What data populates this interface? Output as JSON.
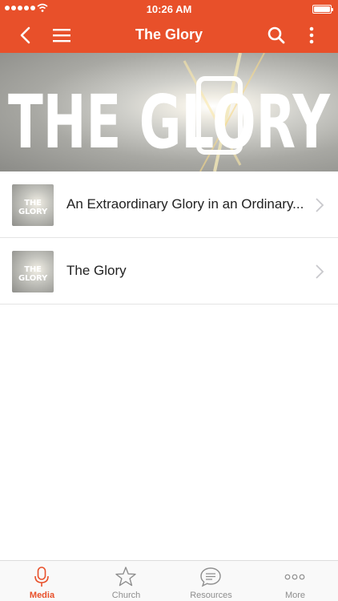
{
  "status_bar": {
    "time": "10:26 AM"
  },
  "nav": {
    "title": "The Glory"
  },
  "banner": {
    "title_text": "THE GLORY"
  },
  "list": {
    "items": [
      {
        "title": "An Extraordinary Glory in an Ordinary...",
        "thumb_text": "THE GLORY"
      },
      {
        "title": "The Glory",
        "thumb_text": "THE GLORY"
      }
    ]
  },
  "tabs": [
    {
      "label": "Media",
      "icon": "microphone-icon",
      "active": true
    },
    {
      "label": "Church",
      "icon": "star-icon",
      "active": false
    },
    {
      "label": "Resources",
      "icon": "chat-bubble-icon",
      "active": false
    },
    {
      "label": "More",
      "icon": "ellipsis-icon",
      "active": false
    }
  ],
  "colors": {
    "accent": "#e8502a",
    "tab_inactive": "#8e8e8e"
  }
}
